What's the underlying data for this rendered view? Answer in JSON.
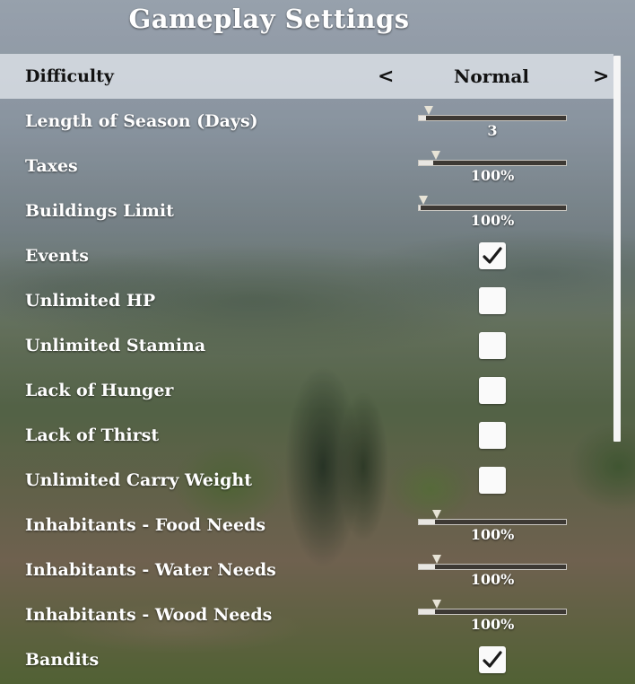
{
  "title": "Gameplay Settings",
  "settings": [
    {
      "id": "difficulty",
      "label": "Difficulty",
      "type": "chooser",
      "value": "Normal",
      "prev": "<",
      "next": ">",
      "selected": true
    },
    {
      "id": "season-length",
      "label": "Length of Season (Days)",
      "type": "slider",
      "value": "3",
      "level": 0.05
    },
    {
      "id": "taxes",
      "label": "Taxes",
      "type": "slider",
      "value": "100%",
      "level": 0.1
    },
    {
      "id": "buildings-limit",
      "label": "Buildings Limit",
      "type": "slider",
      "value": "100%",
      "level": 0.01
    },
    {
      "id": "events",
      "label": "Events",
      "type": "checkbox",
      "checked": true
    },
    {
      "id": "unlimited-hp",
      "label": "Unlimited HP",
      "type": "checkbox",
      "checked": false
    },
    {
      "id": "unlimited-stamina",
      "label": "Unlimited Stamina",
      "type": "checkbox",
      "checked": false
    },
    {
      "id": "lack-of-hunger",
      "label": "Lack of Hunger",
      "type": "checkbox",
      "checked": false
    },
    {
      "id": "lack-of-thirst",
      "label": "Lack of Thirst",
      "type": "checkbox",
      "checked": false
    },
    {
      "id": "unlimited-carry-weight",
      "label": "Unlimited Carry Weight",
      "type": "checkbox",
      "checked": false
    },
    {
      "id": "food-needs",
      "label": "Inhabitants - Food Needs",
      "type": "slider",
      "value": "100%",
      "level": 0.11
    },
    {
      "id": "water-needs",
      "label": "Inhabitants - Water Needs",
      "type": "slider",
      "value": "100%",
      "level": 0.11
    },
    {
      "id": "wood-needs",
      "label": "Inhabitants - Wood Needs",
      "type": "slider",
      "value": "100%",
      "level": 0.11
    },
    {
      "id": "bandits",
      "label": "Bandits",
      "type": "checkbox",
      "checked": true
    }
  ],
  "colors": {
    "selected_row": "#dce0e6",
    "checkbox": "#fafafa",
    "track": "#3d3934"
  }
}
